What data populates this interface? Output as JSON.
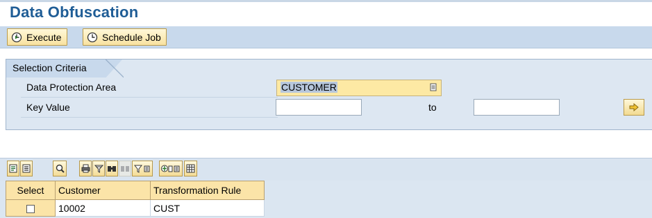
{
  "page": {
    "title": "Data Obfuscation"
  },
  "toolbar": {
    "execute_label": "Execute",
    "schedule_label": "Schedule Job"
  },
  "selection": {
    "tab_label": "Selection Criteria",
    "dpa_label": "Data Protection Area",
    "dpa_value": "CUSTOMER",
    "key_label": "Key Value",
    "key_from": "",
    "to_label": "to",
    "key_to": ""
  },
  "alv": {
    "icons": [
      "details-icon",
      "select-all-icon",
      "search-icon",
      "print-icon",
      "filter-icon",
      "find-icon",
      "find-next-icon",
      "filter-menu-icon",
      "export-menu-icon",
      "layout-icon"
    ]
  },
  "grid": {
    "headers": [
      "Select",
      "Customer",
      "Transformation Rule"
    ],
    "rows": [
      {
        "selected": false,
        "customer": "10002",
        "rule": "CUST"
      }
    ]
  }
}
